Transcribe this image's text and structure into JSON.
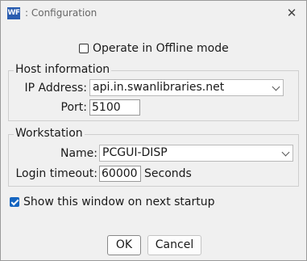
{
  "window": {
    "app_icon": "WF",
    "title": ": Configuration",
    "close_icon": "✕"
  },
  "offline": {
    "label": "Operate in Offline mode",
    "checked": false
  },
  "host": {
    "legend": "Host information",
    "ip_label": "IP Address:",
    "ip_value": "api.in.swanlibraries.net",
    "port_label": "Port:",
    "port_value": "5100"
  },
  "workstation": {
    "legend": "Workstation",
    "name_label": "Name:",
    "name_value": "PCGUI-DISP",
    "timeout_label": "Login timeout:",
    "timeout_value": "60000",
    "timeout_unit": "Seconds"
  },
  "startup": {
    "label": "Show this window on next startup",
    "checked": true
  },
  "buttons": {
    "ok": "OK",
    "cancel": "Cancel"
  },
  "colors": {
    "accent": "#1565c0",
    "icon": "#2a5db0"
  }
}
